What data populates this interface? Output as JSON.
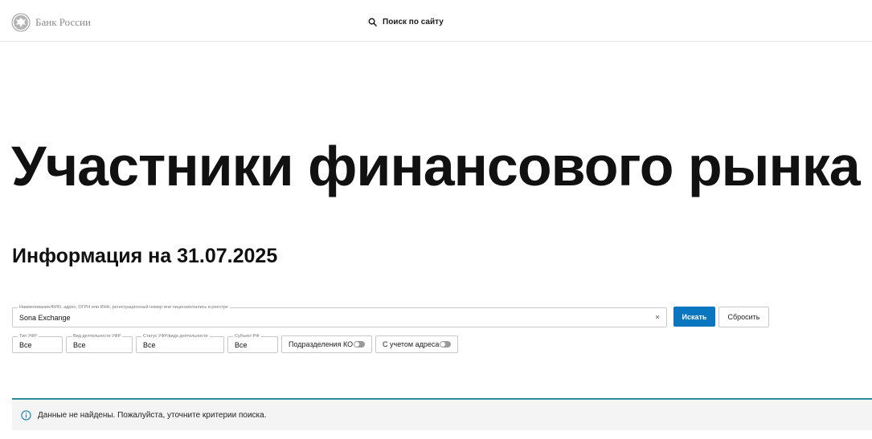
{
  "header": {
    "brand_name": "Банк России",
    "logo_icon": "double-headed-eagle-emblem",
    "search_label": "Поиск по сайту",
    "search_icon": "search-icon"
  },
  "page": {
    "title": "Участники финансового рынка",
    "info_date": "Информация на 31.07.2025"
  },
  "search_form": {
    "query_legend": "Наименование/ФИО, адрес, ОГРН или ИНН, регистрационный номер или лицензия/запись в реестре",
    "query_value": "Sona Exchange",
    "clear_symbol": "×",
    "search_button": "Искать",
    "reset_button": "Сбросить",
    "filters": [
      {
        "legend": "Тип УФР",
        "value": "Все"
      },
      {
        "legend": "Вид деятельности УФР",
        "value": "Все"
      },
      {
        "legend": "Статус УФР/вида деятельности",
        "value": "Все"
      },
      {
        "legend": "Субъект РФ",
        "value": "Все"
      }
    ],
    "toggles": [
      {
        "label": "Подразделения КО",
        "on": false
      },
      {
        "label": "С учетом адреса",
        "on": false
      }
    ]
  },
  "alert": {
    "icon": "info-icon",
    "message": "Данные не найдены. Пожалуйста, уточните критерии поиска."
  },
  "colors": {
    "primary": "#0a76c0",
    "alert_border": "#2a8a9e",
    "alert_bg": "#f4f4f4"
  }
}
